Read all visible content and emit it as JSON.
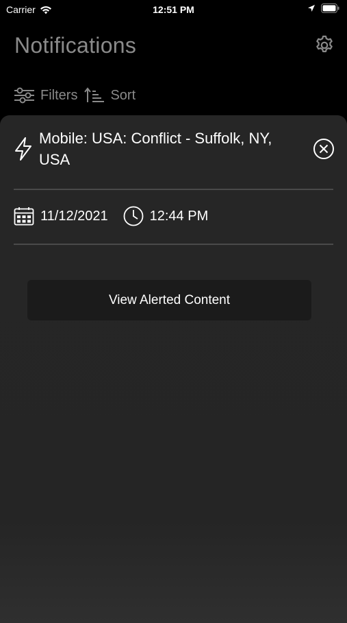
{
  "status_bar": {
    "carrier": "Carrier",
    "time": "12:51 PM"
  },
  "header": {
    "title": "Notifications",
    "settings_icon": "gear-icon"
  },
  "toolbar": {
    "filters_label": "Filters",
    "sort_label": "Sort"
  },
  "alert": {
    "title": "Mobile: USA: Conflict - Suffolk, NY, USA",
    "date": "11/12/2021",
    "time": "12:44 PM",
    "view_button_label": "View Alerted Content"
  },
  "colors": {
    "background": "#000000",
    "sheet": "#262626",
    "title_gray": "#8a8a8a",
    "divider": "#4a4a4a",
    "button": "#1b1b1b"
  }
}
